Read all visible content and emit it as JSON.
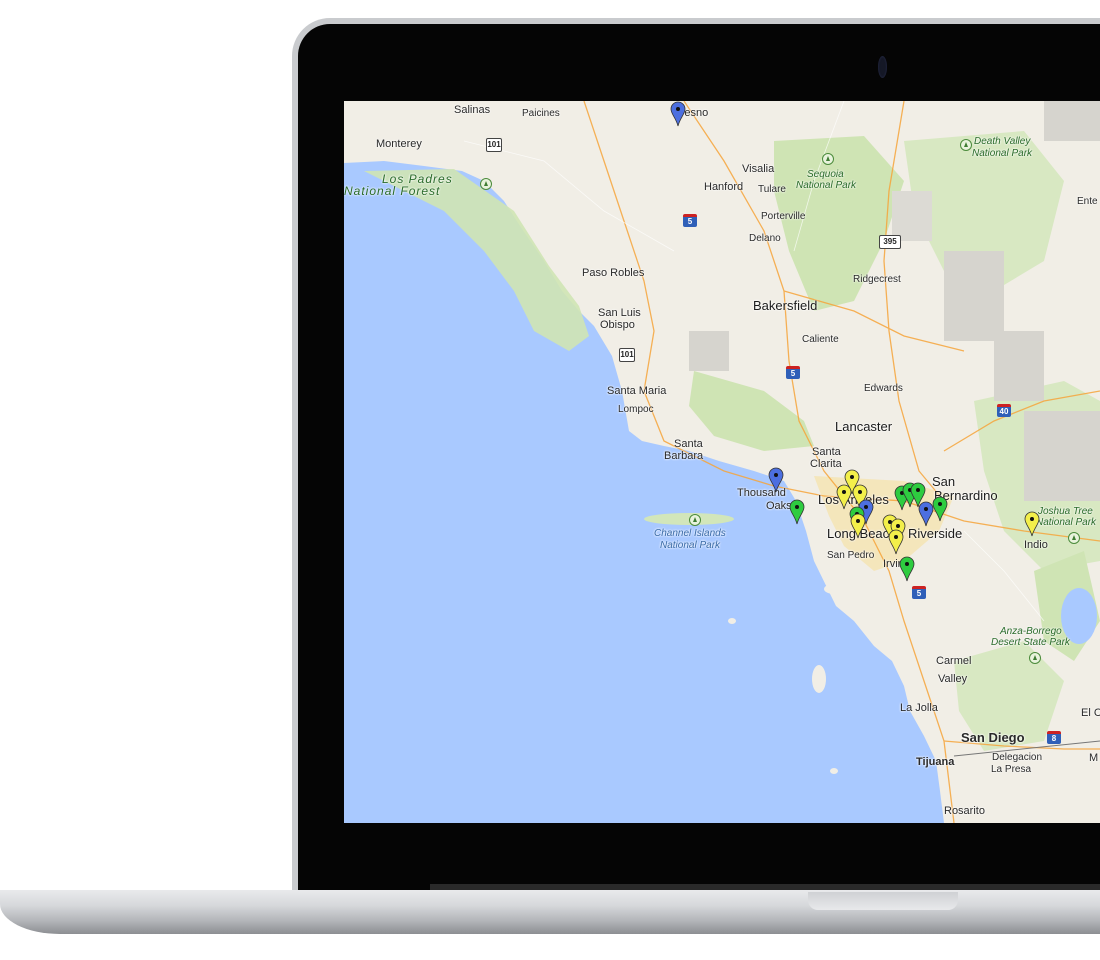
{
  "map": {
    "labels": {
      "salinas": "Salinas",
      "paicines": "Paicines",
      "fresno": "Fresno",
      "monterey": "Monterey",
      "los_padres": "Los Padres",
      "national_forest": "National Forest",
      "visalia": "Visalia",
      "hanford": "Hanford",
      "tulare": "Tulare",
      "sequoia_1": "Sequoia",
      "sequoia_2": "National Park",
      "porterville": "Porterville",
      "delano": "Delano",
      "death_valley_1": "Death Valley",
      "death_valley_2": "National Park",
      "ente": "Ente",
      "paso_robles": "Paso Robles",
      "ridgecrest": "Ridgecrest",
      "bakersfield": "Bakersfield",
      "caliente": "Caliente",
      "san_luis_1": "San Luis",
      "san_luis_2": "Obispo",
      "santa_maria": "Santa Maria",
      "lompoc": "Lompoc",
      "edwards": "Edwards",
      "lancaster": "Lancaster",
      "santa_barbara_1": "Santa",
      "santa_barbara_2": "Barbara",
      "santa_clarita_1": "Santa",
      "santa_clarita_2": "Clarita",
      "thousand_oaks_1": "Thousand",
      "thousand_oaks_2": "Oaks",
      "los_angeles": "Los Angeles",
      "san_bernardino_1": "San",
      "san_bernardino_2": "Bernardino",
      "joshua_tree_1": "Joshua Tree",
      "joshua_tree_2": "National Park",
      "channel_islands_1": "Channel Islands",
      "channel_islands_2": "National Park",
      "long_beach": "Long Beach",
      "riverside": "Riverside",
      "indio": "Indio",
      "san_pedro": "San Pedro",
      "irvine": "Irvine",
      "anza_borrego_1": "Anza-Borrego",
      "anza_borrego_2": "Desert State Park",
      "carmel_valley_1": "Carmel",
      "carmel_valley_2": "Valley",
      "la_jolla": "La Jolla",
      "el_c": "El C",
      "san_diego": "San Diego",
      "tijuana": "Tijuana",
      "delegacion_1": "Delegacion",
      "delegacion_2": "La Presa",
      "m": "M",
      "rosarito": "Rosarito"
    },
    "shields": {
      "us101_a": "101",
      "us101_b": "101",
      "i5_a": "5",
      "i5_b": "5",
      "i5_c": "5",
      "us395": "395",
      "i40": "40",
      "i8": "8"
    },
    "colors": {
      "ocean": "#a9c9ff",
      "land": "#f1eee6",
      "park": "#c5dfa7",
      "pin_blue": "#4c6fe0",
      "pin_green": "#2ecc40",
      "pin_yellow": "#f3ef4a"
    }
  }
}
